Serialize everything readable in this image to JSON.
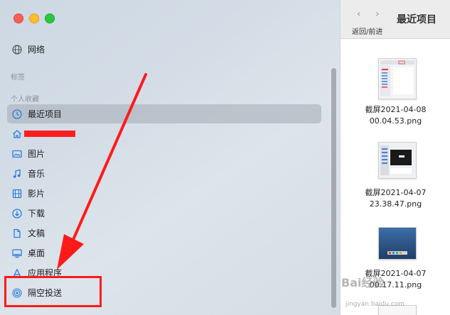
{
  "window": {
    "controls": [
      "close",
      "minimize",
      "maximize"
    ]
  },
  "sidebar": {
    "network_label": "网络",
    "tags_header": "标签",
    "favorites_header": "个人收藏",
    "items": [
      {
        "label": "最近项目",
        "icon": "clock-icon",
        "selected": true
      },
      {
        "label": "",
        "icon": "home-icon",
        "redacted": true
      },
      {
        "label": "图片",
        "icon": "photo-icon"
      },
      {
        "label": "音乐",
        "icon": "music-note-icon"
      },
      {
        "label": "影片",
        "icon": "film-icon"
      },
      {
        "label": "下载",
        "icon": "download-icon"
      },
      {
        "label": "文稿",
        "icon": "document-icon"
      },
      {
        "label": "桌面",
        "icon": "desktop-icon"
      },
      {
        "label": "应用程序",
        "icon": "apps-icon"
      },
      {
        "label": "隔空投送",
        "icon": "airdrop-icon"
      }
    ]
  },
  "toolbar": {
    "title": "最近项目",
    "nav_subtitle": "返回/前进",
    "back_glyph": "‹",
    "forward_glyph": "›"
  },
  "files": [
    {
      "name_line1": "截屏2021-04-08",
      "name_line2": "00.04.53.png"
    },
    {
      "name_line1": "截屏2021-04-07",
      "name_line2": "23.38.47.png"
    },
    {
      "name_line1": "截屏2021-04-07",
      "name_line2": "00.17.11.png"
    }
  ],
  "watermark": {
    "brand": "Bai经验",
    "url": "jingyan.baidu.com"
  },
  "colors": {
    "annotation_red": "#ff1a1a",
    "selection": "#aab2bc",
    "icon_blue": "#2b7de0"
  }
}
